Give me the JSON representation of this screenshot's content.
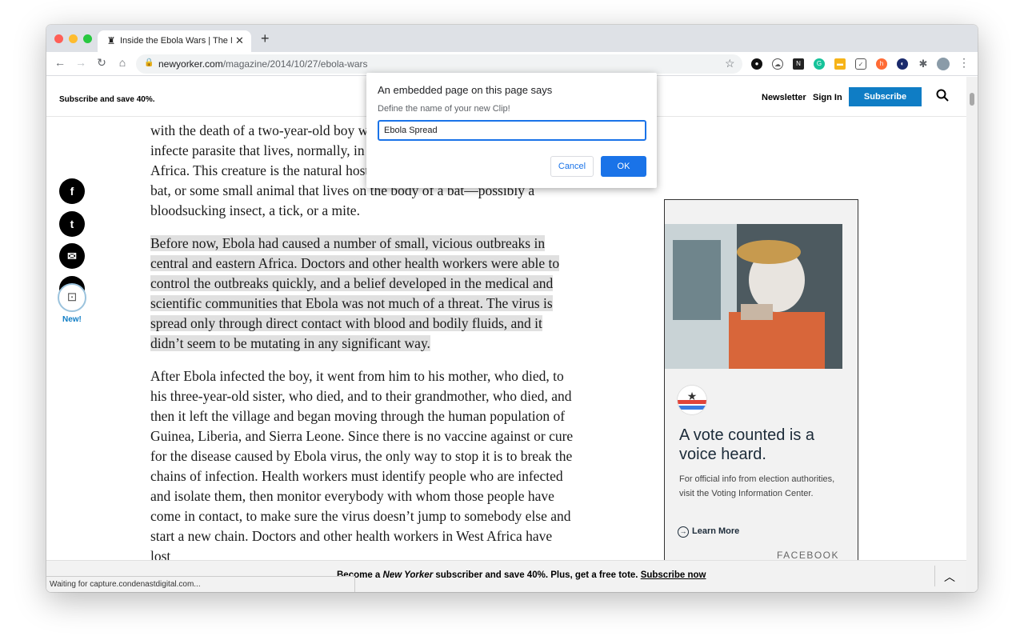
{
  "browser": {
    "tab_title": "Inside the Ebola Wars | The Ne",
    "url_host": "newyorker.com",
    "url_path": "/magazine/2014/10/27/ebola-wars",
    "status_text": "Waiting for capture.condenastdigital.com..."
  },
  "site_header": {
    "promo": "Subscribe and save 40%.",
    "newsletter": "Newsletter",
    "sign_in": "Sign In",
    "subscribe": "Subscribe"
  },
  "share": {
    "facebook": "f",
    "twitter": "t",
    "email": "✉",
    "print": "⎙",
    "new_label": "New!"
  },
  "article": {
    "p1": "with the death of a two-year-old boy wh fever. We now know that he was infecte parasite that lives, normally, in some as y ecosystems of equatorial Africa. This creature is the natural host of Ebola; it could be a type of fruit bat, or some small animal that lives on the body of a bat—possibly a bloodsucking insect, a tick, or a mite.",
    "p2": "Before now, Ebola had caused a number of small, vicious outbreaks in central and eastern Africa. Doctors and other health workers were able to control the outbreaks quickly, and a belief developed in the medical and scientific communities that Ebola was not much of a threat. The virus is spread only through direct contact with blood and bodily fluids, and it didn’t seem to be mutating in any significant way.",
    "p3": "After Ebola infected the boy, it went from him to his mother, who died, to his three-year-old sister, who died, and to their grandmother, who died, and then it left the village and began moving through the human population of Guinea, Liberia, and Sierra Leone. Since there is no vaccine against or cure for the disease caused by Ebola virus, the only way to stop it is to break the chains of infection. Health workers must identify people who are infected and isolate them, then monitor everybody with whom those people have come in contact, to make sure the virus doesn’t jump to somebody else and start a new chain. Doctors and other health workers in West Africa have lost"
  },
  "ad": {
    "headline": "A vote counted is a voice heard.",
    "body": "For official info from election authorities, visit the Voting Information Center.",
    "learn_more": "Learn More",
    "brand": "FACEBOOK"
  },
  "banner": {
    "prefix": "Become a ",
    "italic": "New Yorker",
    "middle": " subscriber and save 40%. Plus, get a free tote. ",
    "link": "Subscribe now"
  },
  "dialog": {
    "title": "An embedded page on this page says",
    "message": "Define the name of your new Clip!",
    "input_value": "Ebola Spread",
    "cancel": "Cancel",
    "ok": "OK"
  }
}
